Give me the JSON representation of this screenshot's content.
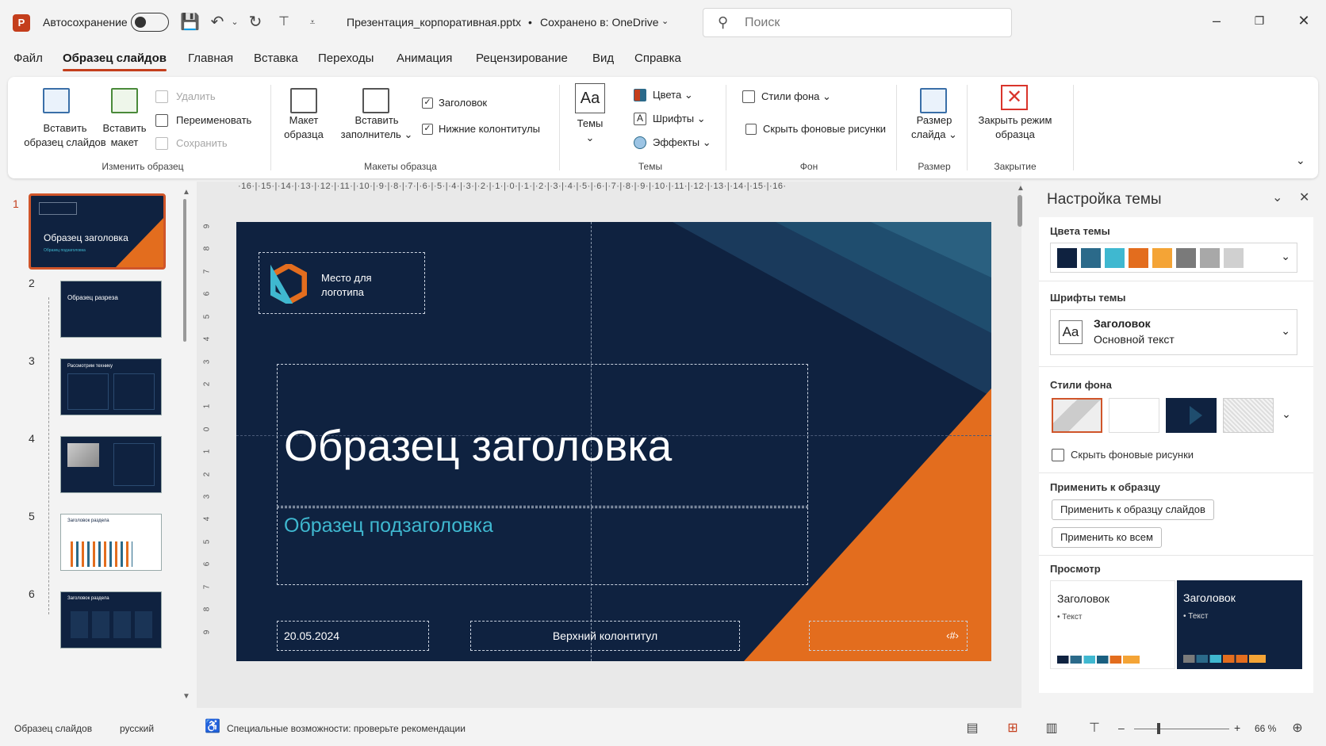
{
  "app": {
    "logo_letter": "P"
  },
  "titlebar": {
    "autosave_label": "Автосохранение",
    "doc_title": "Презентация_корпоративная.pptx",
    "saved_status": "Сохранено в: OneDrive",
    "search_placeholder": "Поиск"
  },
  "menu": {
    "items": [
      "Файл",
      "Образец слайдов",
      "Главная",
      "Вставка",
      "Переходы",
      "Анимация",
      "Рецензирование",
      "Вид",
      "Справка"
    ],
    "active": "Образец слайдов"
  },
  "ribbon": {
    "insert_master_l1": "Вставить",
    "insert_master_l2": "образец слайдов",
    "insert_layout_l1": "Вставить",
    "insert_layout_l2": "макет",
    "delete": "Удалить",
    "rename": "Переименовать",
    "preserve": "Сохранить",
    "group_edit_master": "Изменить образец",
    "master_layout_l1": "Макет",
    "master_layout_l2": "образца",
    "insert_placeholder_l1": "Вставить",
    "insert_placeholder_l2": "заполнитель",
    "title_check": "Заголовок",
    "footers_check": "Нижние колонтитулы",
    "group_master_layout": "Макеты образца",
    "themes_icon_text": "Aa",
    "themes": "Темы",
    "colors": "Цвета",
    "fonts": "Шрифты",
    "effects": "Эффекты",
    "group_themes": "Темы",
    "bg_styles": "Стили фона",
    "hide_bg": "Скрыть фоновые рисунки",
    "group_background": "Фон",
    "slide_size_l1": "Размер",
    "slide_size_l2": "слайда",
    "group_size": "Размер",
    "close_master_l1": "Закрыть режим",
    "close_master_l2": "образца",
    "group_close": "Закрытие"
  },
  "thumbnails": [
    {
      "num": "1",
      "title": "Образец заголовка",
      "subtitle": "Образец подзаголовка"
    },
    {
      "num": "2",
      "title": "Образец разреза"
    },
    {
      "num": "3",
      "title": "Рассмотрим технику"
    },
    {
      "num": "4",
      "title": ""
    },
    {
      "num": "5",
      "title": "Заголовок раздела"
    },
    {
      "num": "6",
      "title": "Заголовок раздела"
    }
  ],
  "ruler": {
    "horizontal": "·16·|·15·|·14·|·13·|·12·|·11·|·10·|·9·|·8·|·7·|·6·|·5·|·4·|·3·|·2·|·1·|·0·|·1·|·2·|·3·|·4·|·5·|·6·|·7·|·8·|·9·|·10·|·11·|·12·|·13·|·14·|·15·|·16·",
    "vertical": [
      "9",
      "8",
      "7",
      "6",
      "5",
      "4",
      "3",
      "2",
      "1",
      "0",
      "1",
      "2",
      "3",
      "4",
      "5",
      "6",
      "7",
      "8",
      "9"
    ]
  },
  "slide": {
    "logo_text_l1": "Место для",
    "logo_text_l2": "логотипа",
    "title": "Образец заголовка",
    "subtitle": "Образец подзаголовка",
    "date": "20.05.2024",
    "footer": "Верхний колонтитул",
    "slide_number": "‹#›",
    "colors": {
      "bg": "#0f2240",
      "accent": "#e36d1e",
      "teal": "#1a5f80",
      "light_teal": "#3fb8d0"
    }
  },
  "theme_pane": {
    "title": "Настройка темы",
    "colors_heading": "Цвета темы",
    "swatches": [
      "#0f2240",
      "#2b6a8a",
      "#3fb8d0",
      "#e36d1e",
      "#f4a436",
      "#7a7a7a",
      "#a8a8a8",
      "#d0d0d0"
    ],
    "fonts_heading": "Шрифты темы",
    "fonts_icon": "Aa",
    "font_heading_name": "Заголовок",
    "font_body_name": "Основной текст",
    "bg_heading": "Стили фона",
    "hide_bg": "Скрыть фоновые рисунки",
    "apply_heading": "Применить к образцу",
    "apply_master_btn": "Применить к образцу слайдов",
    "apply_all_btn": "Применить ко всем",
    "preview_heading": "Просмотр",
    "preview_light_title": "Заголовок",
    "preview_light_text": "• Текст",
    "preview_dark_title": "Заголовок",
    "preview_dark_text": "• Текст"
  },
  "status": {
    "view_mode": "Образец слайдов",
    "language": "русский",
    "accessibility": "Специальные возможности: проверьте рекомендации",
    "zoom": "66 %"
  }
}
